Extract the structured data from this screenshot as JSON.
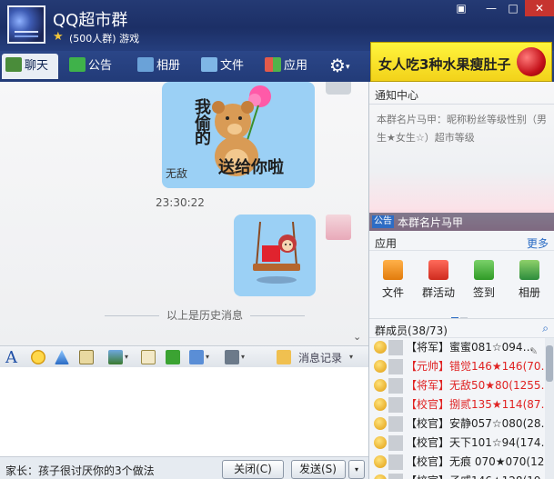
{
  "window": {
    "group_name": "QQ超市群",
    "group_meta": "(500人群) 游戏",
    "close_glyph": "✕",
    "min_glyph": "—",
    "max_glyph": "□",
    "skin_glyph": "▣"
  },
  "tabs": [
    {
      "label": "聊天",
      "icon": "chat-icon"
    },
    {
      "label": "公告",
      "icon": "notice-icon"
    },
    {
      "label": "相册",
      "icon": "album-icon"
    },
    {
      "label": "文件",
      "icon": "folder-icon"
    },
    {
      "label": "应用",
      "icon": "apps-icon"
    },
    {
      "label": "",
      "icon": "gear-icon"
    }
  ],
  "ad": {
    "text": "女人吃3种水果瘦肚子"
  },
  "chat": {
    "sender_name": "无敌",
    "sticker1_text": {
      "line1": "我",
      "line2": "偷",
      "line3": "的",
      "line4": "送给你啦"
    },
    "time": "23:30:22",
    "history_separator": "以上是历史消息"
  },
  "input_toolbar": {
    "history_label": "消息记录",
    "font_glyph": "A",
    "dropdown_glyph": "▾"
  },
  "bottom_bar": {
    "ad_text": "家长：孩子很讨厌你的3个做法",
    "close_label": "关闭(C)",
    "send_label": "发送(S)",
    "send_dropdown": "▾"
  },
  "notice_center": {
    "title": "通知中心",
    "body": "本群名片马甲：昵称粉丝等级性别（男生★女生☆）超市等级",
    "tag": "公告",
    "footer": "本群名片马甲"
  },
  "apps": {
    "title": "应用",
    "more": "更多",
    "items": [
      {
        "label": "文件",
        "icon": "folder-icon"
      },
      {
        "label": "群活动",
        "icon": "flag-icon"
      },
      {
        "label": "签到",
        "icon": "checkin-icon"
      },
      {
        "label": "相册",
        "icon": "photo-icon"
      }
    ]
  },
  "members": {
    "title": "群成员(38/73)",
    "search_glyph": "⌕",
    "list": [
      {
        "name": "【将军】蜜蜜081☆094…",
        "color": "#222222"
      },
      {
        "name": "【元帅】错觉146★146(70…",
        "color": "#e02222"
      },
      {
        "name": "【将军】无敌50★80(1255…",
        "color": "#e02222"
      },
      {
        "name": "【校官】捌贰135★114(87…",
        "color": "#e02222"
      },
      {
        "name": "【校官】安静057☆080(28…",
        "color": "#222222"
      },
      {
        "name": "【校官】天下101☆94(174…",
        "color": "#222222"
      },
      {
        "name": "【校官】无痕 070★070(12…",
        "color": "#222222"
      },
      {
        "name": "【校官】子戚146★128(19…",
        "color": "#222222"
      }
    ]
  }
}
